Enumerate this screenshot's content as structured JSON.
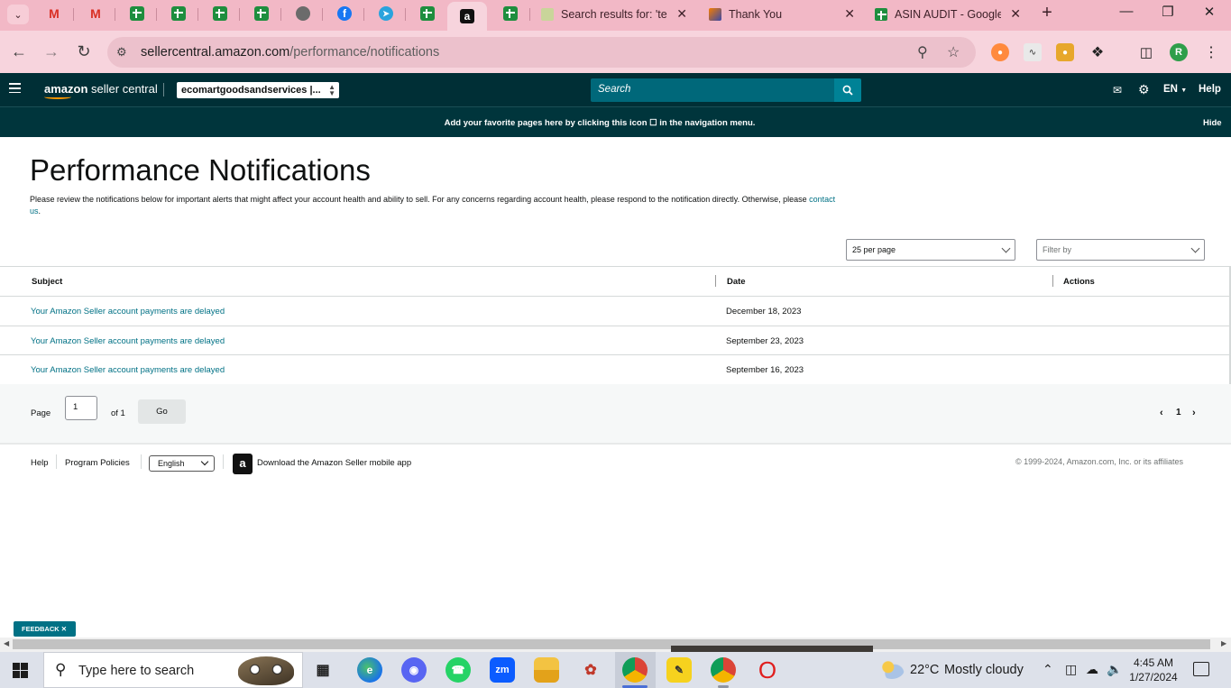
{
  "browser": {
    "tabs": [
      {
        "icon": "gmail-icon",
        "title": ""
      },
      {
        "icon": "gmail-icon",
        "title": ""
      },
      {
        "icon": "sheets-icon",
        "title": ""
      },
      {
        "icon": "sheets-icon",
        "title": ""
      },
      {
        "icon": "sheets-icon",
        "title": ""
      },
      {
        "icon": "sheets-icon",
        "title": ""
      },
      {
        "icon": "globe-icon",
        "title": ""
      },
      {
        "icon": "facebook-icon",
        "title": ""
      },
      {
        "icon": "telegram-icon",
        "title": ""
      },
      {
        "icon": "sheets-icon",
        "title": ""
      },
      {
        "icon": "amazon-icon",
        "title": "",
        "active": true
      },
      {
        "icon": "sheets-icon",
        "title": ""
      }
    ],
    "wide_tabs": [
      {
        "icon": "leaf-icon",
        "title": "Search results for: 'te"
      },
      {
        "icon": "pencil-icon",
        "title": "Thank You"
      },
      {
        "icon": "sheets-icon",
        "title": "ASIN AUDIT - Google"
      }
    ],
    "url_host": "sellercentral.amazon.com",
    "url_path": "/performance/notifications",
    "profile_initial": "R"
  },
  "header": {
    "logo_brand": "amazon",
    "logo_product": "seller central",
    "account": "ecomartgoodsandservices |...",
    "search_placeholder": "Search",
    "language": "EN",
    "help": "Help"
  },
  "banner": {
    "message": "Add your favorite pages here by clicking this icon ☐ in the navigation menu.",
    "hide": "Hide"
  },
  "page": {
    "title": "Performance Notifications",
    "intro": "Please review the notifications below for important alerts that might affect your account health and ability to sell. For any concerns regarding account health, please respond to the notification directly. Otherwise, please",
    "contact_link": "contact us",
    "intro_end": ".",
    "per_page": "25 per page",
    "filter_placeholder": "Filter by"
  },
  "table": {
    "columns": [
      "Subject",
      "Date",
      "Actions"
    ],
    "rows": [
      {
        "subject": "Your Amazon Seller account payments are delayed",
        "date": "December 18, 2023"
      },
      {
        "subject": "Your Amazon Seller account payments are delayed",
        "date": "September 23, 2023"
      },
      {
        "subject": "Your Amazon Seller account payments are delayed",
        "date": "September 16, 2023"
      }
    ]
  },
  "pager": {
    "page_label": "Page",
    "page_value": "1",
    "of_label": "of 1",
    "go_label": "Go",
    "current_page": "1"
  },
  "footer": {
    "help": "Help",
    "policies": "Program Policies",
    "language": "English",
    "app_link": "Download the Amazon Seller mobile app",
    "copyright": "© 1999-2024, Amazon.com, Inc. or its affiliates"
  },
  "feedback_label": "FEEDBACK",
  "taskbar": {
    "search_placeholder": "Type here to search",
    "weather_temp": "22°C",
    "weather_text": "Mostly cloudy",
    "time": "4:45 AM",
    "date": "1/27/2024"
  },
  "colors": {
    "header_bg": "#002f36",
    "link": "#007185",
    "tab_strip": "#f2b8c6"
  }
}
